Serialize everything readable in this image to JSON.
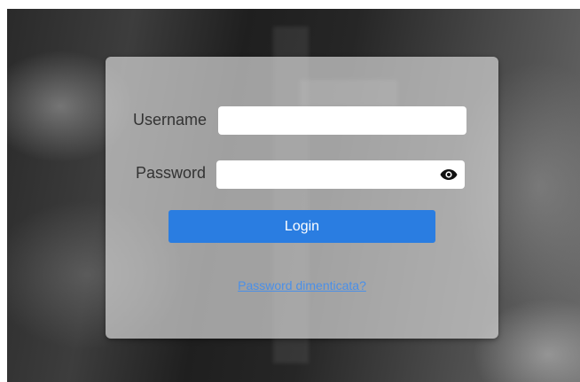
{
  "login": {
    "username_label": "Username",
    "username_value": "",
    "password_label": "Password",
    "password_value": "",
    "show_password_icon": "eye-icon",
    "login_button": "Login",
    "forgot_link": "Password dimenticata?"
  },
  "colors": {
    "accent": "#2a7de1",
    "link": "#4a8fe8",
    "card_bg": "#d2d2d2"
  }
}
